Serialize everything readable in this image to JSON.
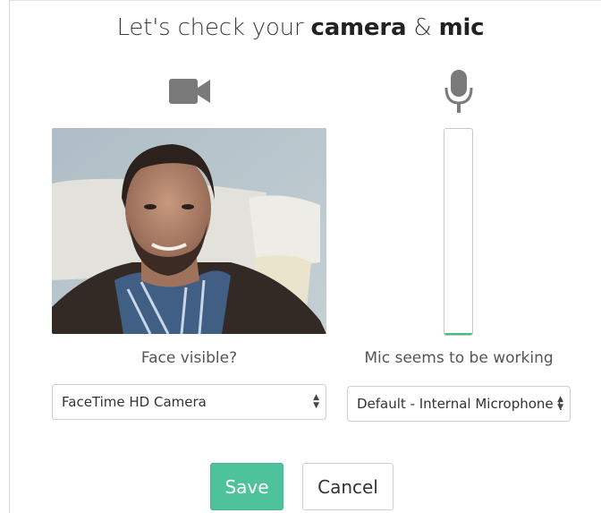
{
  "title": {
    "prefix": "Let's check your ",
    "camera": "camera",
    "amp": " & ",
    "mic": "mic"
  },
  "icons": {
    "camera": "video-camera-icon",
    "mic": "microphone-icon"
  },
  "camera": {
    "caption": "Face visible?",
    "device_selected": "FaceTime HD Camera"
  },
  "mic": {
    "caption": "Mic seems to be working",
    "device_selected": "Default - Internal Microphone (",
    "level_fraction": 0.01
  },
  "actions": {
    "save_label": "Save",
    "cancel_label": "Cancel"
  },
  "colors": {
    "accent": "#4ec39b",
    "meter": "#3cc47c",
    "icon": "#7a7a7a"
  }
}
